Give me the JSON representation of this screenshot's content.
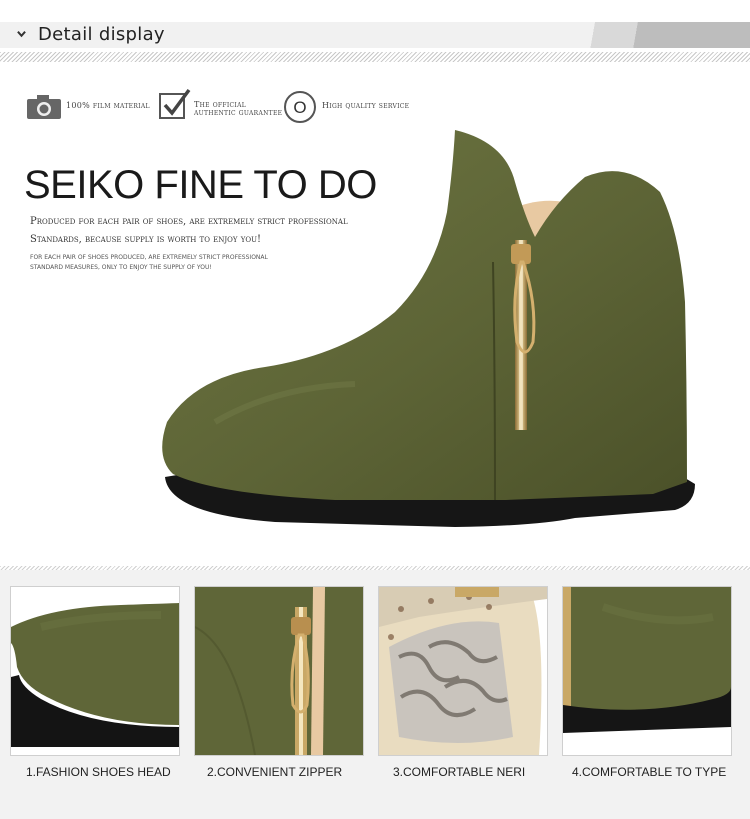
{
  "header": {
    "title": "Detail display"
  },
  "badges": [
    {
      "icon": "camera-icon",
      "label": "100% film material"
    },
    {
      "icon": "checkmark-icon",
      "label": "The official authentic guarantee"
    },
    {
      "icon": "letter-o-icon",
      "glyph": "O",
      "label": "High quality service"
    }
  ],
  "hero": {
    "title": "SEIKO FINE TO DO",
    "desc_line1": "Produced for each pair of shoes, are extremely strict professional",
    "desc_line2": "Standards, because supply is worth to enjoy you!",
    "small_line1": "for each pair of shoes produced, are extremely strict professional",
    "small_line2": "standard measures, only to enjoy the supply of you!"
  },
  "thumbnails": [
    {
      "caption": "1.FASHION SHOES HEAD"
    },
    {
      "caption": "2.CONVENIENT ZIPPER"
    },
    {
      "caption": "3.COMFORTABLE NERI"
    },
    {
      "caption": "4.COMFORTABLE TO TYPE"
    }
  ],
  "colors": {
    "suede": "#5f6638",
    "sole": "#161616",
    "zipper": "#c9a866"
  }
}
